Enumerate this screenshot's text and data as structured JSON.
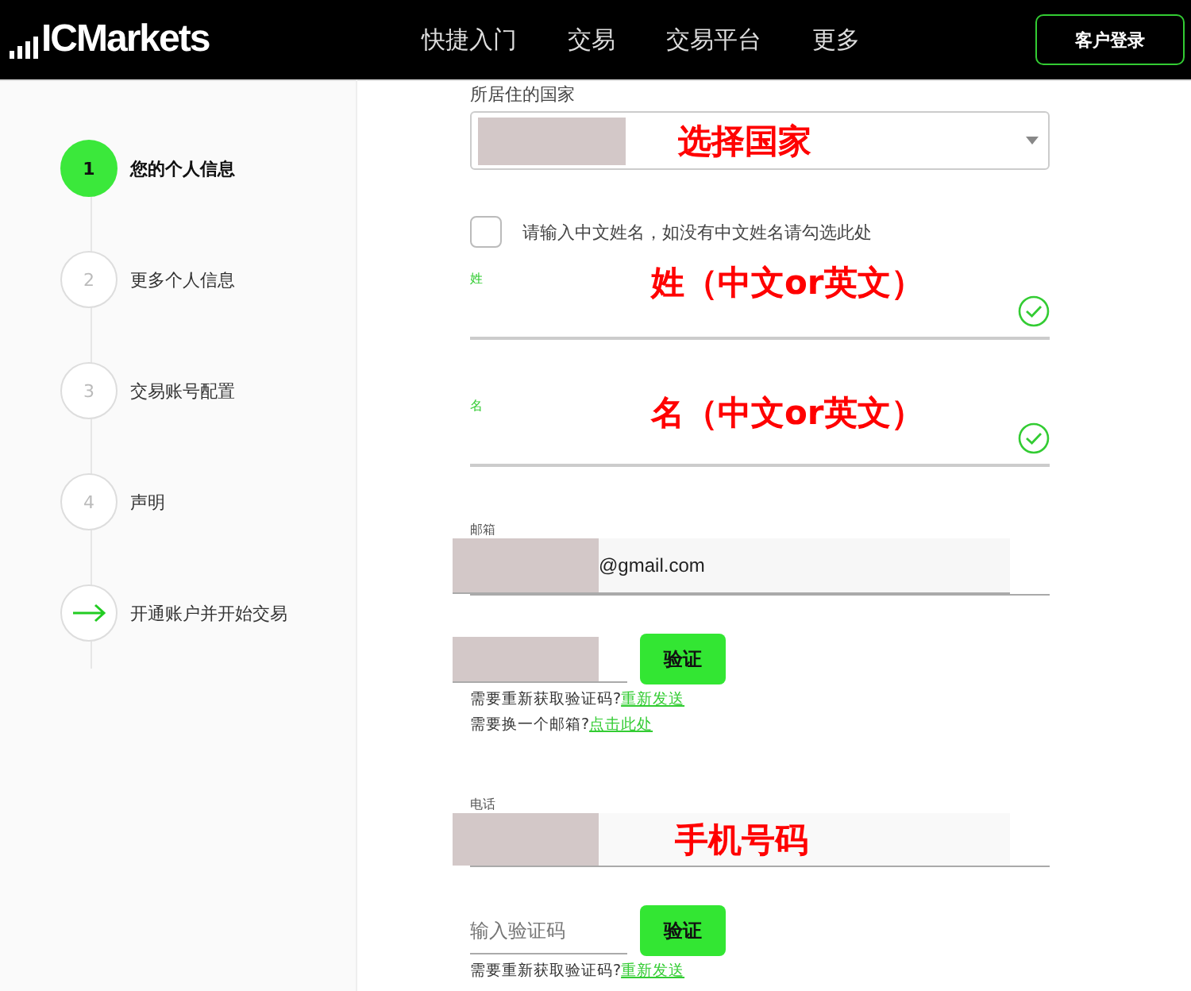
{
  "header": {
    "logo": "ICMarkets",
    "nav": [
      "快捷入门",
      "交易",
      "交易平台",
      "更多"
    ],
    "login_button": "客户登录"
  },
  "steps": [
    {
      "kind": "number",
      "number": "1",
      "label": "您的个人信息",
      "selected": true
    },
    {
      "kind": "number",
      "number": "2",
      "label": "更多个人信息",
      "selected": false
    },
    {
      "kind": "number",
      "number": "3",
      "label": "交易账号配置",
      "selected": false
    },
    {
      "kind": "number",
      "number": "4",
      "label": "声明",
      "selected": false
    },
    {
      "kind": "arrow",
      "label": "开通账户并开始交易"
    }
  ],
  "form": {
    "country": {
      "label": "所居住的国家",
      "annotation": "选择国家"
    },
    "no_chinese_name": {
      "label": "请输入中文姓名，如没有中文姓名请勾选此处",
      "checked": false
    },
    "surname": {
      "label": "姓",
      "annotation": "姓（中文or英文）",
      "valid": true
    },
    "given_name": {
      "label": "名",
      "annotation": "名（中文or英文）",
      "valid": true
    },
    "email": {
      "label": "邮箱",
      "value": "@gmail.com"
    },
    "email_code": {
      "button": "验证",
      "hints": [
        {
          "text": "需要重新获取验证码?",
          "link": "重新发送"
        },
        {
          "text": "需要换一个邮箱?",
          "link": "点击此处"
        }
      ]
    },
    "phone": {
      "label": "电话",
      "annotation": "手机号码"
    },
    "phone_code": {
      "placeholder": "输入验证码",
      "button": "验证",
      "hints": [
        {
          "text": "需要重新获取验证码?",
          "link": "重新发送"
        }
      ]
    }
  }
}
